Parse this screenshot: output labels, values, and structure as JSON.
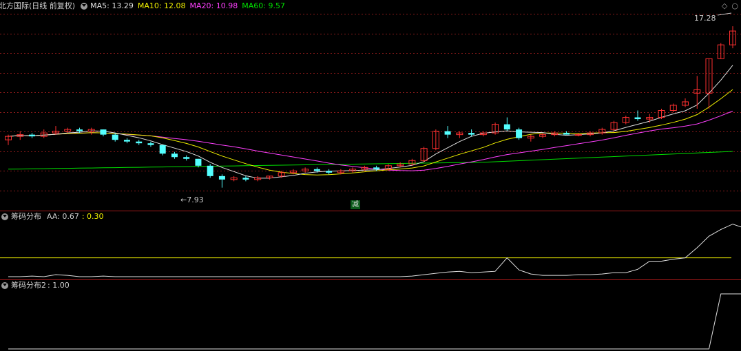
{
  "main": {
    "title": "北方国际(日线 前复权)",
    "ma5_label": "MA5:",
    "ma5_value": "13.29",
    "ma10_label": "MA10:",
    "ma10_value": "12.08",
    "ma20_label": "MA20:",
    "ma20_value": "10.98",
    "ma60_label": "MA60:",
    "ma60_value": "9.57",
    "high_label": "17.28",
    "low_label": "7.93",
    "reduce_marker": "减",
    "colors": {
      "up": "#ff3030",
      "down": "#54ffff",
      "ma5": "#e0e0e0",
      "ma10": "#f0f000",
      "ma20": "#ff40ff",
      "ma60": "#00e000",
      "grid": "#8a1a1a"
    }
  },
  "indicator1": {
    "name": "筹码分布",
    "aa_label": "AA: 0.67",
    "second_value": ": 0.30"
  },
  "indicator2": {
    "name": "筹码分布2",
    "value": ": 1.00"
  },
  "corner_icons": [
    "diamond-icon",
    "circle-icon"
  ],
  "chart_data": {
    "type": "candlestick",
    "y_range": [
      7.0,
      18.0
    ],
    "candles": [
      [
        10.7,
        11.0,
        10.4,
        10.9
      ],
      [
        10.9,
        11.2,
        10.7,
        11.0
      ],
      [
        11.0,
        11.1,
        10.8,
        10.9
      ],
      [
        10.9,
        11.3,
        10.8,
        11.1
      ],
      [
        11.1,
        11.5,
        11.0,
        11.2
      ],
      [
        11.2,
        11.4,
        11.1,
        11.3
      ],
      [
        11.3,
        11.4,
        11.1,
        11.2
      ],
      [
        11.2,
        11.4,
        11.0,
        11.3
      ],
      [
        11.3,
        11.3,
        10.9,
        11.0
      ],
      [
        11.0,
        11.1,
        10.6,
        10.7
      ],
      [
        10.7,
        10.8,
        10.5,
        10.6
      ],
      [
        10.6,
        10.7,
        10.4,
        10.5
      ],
      [
        10.5,
        10.6,
        10.3,
        10.4
      ],
      [
        10.4,
        10.4,
        9.8,
        9.9
      ],
      [
        9.9,
        10.0,
        9.6,
        9.7
      ],
      [
        9.7,
        9.8,
        9.5,
        9.6
      ],
      [
        9.6,
        9.6,
        9.1,
        9.2
      ],
      [
        9.2,
        9.3,
        8.5,
        8.6
      ],
      [
        8.6,
        8.7,
        7.93,
        8.4
      ],
      [
        8.4,
        8.6,
        8.3,
        8.5
      ],
      [
        8.5,
        8.6,
        8.3,
        8.4
      ],
      [
        8.4,
        8.6,
        8.3,
        8.5
      ],
      [
        8.5,
        8.6,
        8.4,
        8.6
      ],
      [
        8.6,
        8.9,
        8.5,
        8.8
      ],
      [
        8.8,
        9.0,
        8.7,
        8.9
      ],
      [
        8.9,
        9.1,
        8.8,
        9.0
      ],
      [
        9.0,
        9.1,
        8.8,
        8.9
      ],
      [
        8.9,
        9.0,
        8.7,
        8.8
      ],
      [
        8.8,
        9.0,
        8.7,
        8.9
      ],
      [
        8.9,
        9.1,
        8.8,
        9.0
      ],
      [
        9.0,
        9.2,
        8.9,
        9.1
      ],
      [
        9.1,
        9.2,
        8.9,
        9.0
      ],
      [
        9.0,
        9.3,
        8.9,
        9.2
      ],
      [
        9.2,
        9.4,
        9.1,
        9.3
      ],
      [
        9.3,
        9.6,
        9.2,
        9.5
      ],
      [
        9.5,
        10.3,
        9.4,
        10.2
      ],
      [
        10.2,
        11.3,
        10.1,
        11.2
      ],
      [
        11.2,
        11.5,
        10.8,
        11.0
      ],
      [
        11.0,
        11.2,
        10.8,
        11.1
      ],
      [
        11.1,
        11.3,
        10.9,
        11.0
      ],
      [
        11.0,
        11.2,
        10.9,
        11.1
      ],
      [
        11.1,
        11.7,
        11.0,
        11.6
      ],
      [
        11.6,
        12.0,
        11.2,
        11.3
      ],
      [
        11.3,
        11.4,
        10.7,
        10.8
      ],
      [
        10.8,
        11.0,
        10.6,
        10.9
      ],
      [
        10.9,
        11.1,
        10.8,
        11.0
      ],
      [
        11.0,
        11.2,
        10.9,
        11.1
      ],
      [
        11.1,
        11.2,
        11.0,
        11.0
      ],
      [
        11.0,
        11.1,
        10.9,
        11.0
      ],
      [
        11.0,
        11.2,
        10.9,
        11.1
      ],
      [
        11.1,
        11.4,
        11.0,
        11.3
      ],
      [
        11.3,
        11.8,
        11.2,
        11.7
      ],
      [
        11.7,
        12.1,
        11.6,
        12.0
      ],
      [
        12.0,
        12.4,
        11.8,
        11.9
      ],
      [
        11.9,
        12.2,
        11.7,
        12.0
      ],
      [
        12.0,
        12.5,
        11.9,
        12.4
      ],
      [
        12.4,
        12.8,
        12.3,
        12.7
      ],
      [
        12.7,
        13.1,
        12.6,
        12.9
      ],
      [
        13.4,
        14.4,
        12.5,
        13.6
      ],
      [
        13.4,
        15.4,
        12.5,
        15.4
      ],
      [
        15.4,
        16.3,
        15.4,
        16.2
      ],
      [
        16.2,
        17.28,
        16.0,
        17.0
      ]
    ],
    "ind1_values": [
      0.02,
      0.02,
      0.03,
      0.02,
      0.05,
      0.04,
      0.02,
      0.02,
      0.03,
      0.02,
      0.02,
      0.02,
      0.02,
      0.02,
      0.02,
      0.02,
      0.02,
      0.02,
      0.02,
      0.02,
      0.02,
      0.02,
      0.02,
      0.02,
      0.02,
      0.02,
      0.02,
      0.02,
      0.02,
      0.02,
      0.02,
      0.02,
      0.02,
      0.02,
      0.03,
      0.05,
      0.07,
      0.09,
      0.1,
      0.08,
      0.09,
      0.1,
      0.3,
      0.12,
      0.06,
      0.04,
      0.04,
      0.04,
      0.05,
      0.05,
      0.06,
      0.08,
      0.08,
      0.13,
      0.25,
      0.25,
      0.28,
      0.3,
      0.45,
      0.62,
      0.72,
      0.8,
      0.74,
      0.8
    ],
    "ind1_ref": 0.3,
    "ind2_values": [
      0,
      0,
      0,
      0,
      0,
      0,
      0,
      0,
      0,
      0,
      0,
      0,
      0,
      0,
      0,
      0,
      0,
      0,
      0,
      0,
      0,
      0,
      0,
      0,
      0,
      0,
      0,
      0,
      0,
      0,
      0,
      0,
      0,
      0,
      0,
      0,
      0,
      0,
      0,
      0,
      0,
      0,
      0,
      0,
      0,
      0,
      0,
      0,
      0,
      0,
      0,
      0,
      0,
      0,
      0,
      0,
      0,
      0,
      0,
      0,
      1,
      1,
      1,
      1
    ]
  }
}
